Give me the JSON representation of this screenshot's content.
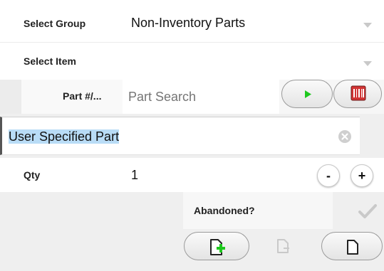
{
  "select_group": {
    "label": "Select Group",
    "value": "Non-Inventory Parts"
  },
  "select_item": {
    "label": "Select Item",
    "value": ""
  },
  "part_search": {
    "label": "Part #/...",
    "placeholder": "Part Search"
  },
  "custom_part": {
    "value": "User Specified Part"
  },
  "qty": {
    "label": "Qty",
    "value": "1",
    "minus": "-",
    "plus": "+"
  },
  "abandoned": {
    "label": "Abandoned?"
  },
  "colors": {
    "accent_green": "#1ec81e",
    "highlight": "#b9dcf6",
    "focus_bar": "#555555"
  }
}
